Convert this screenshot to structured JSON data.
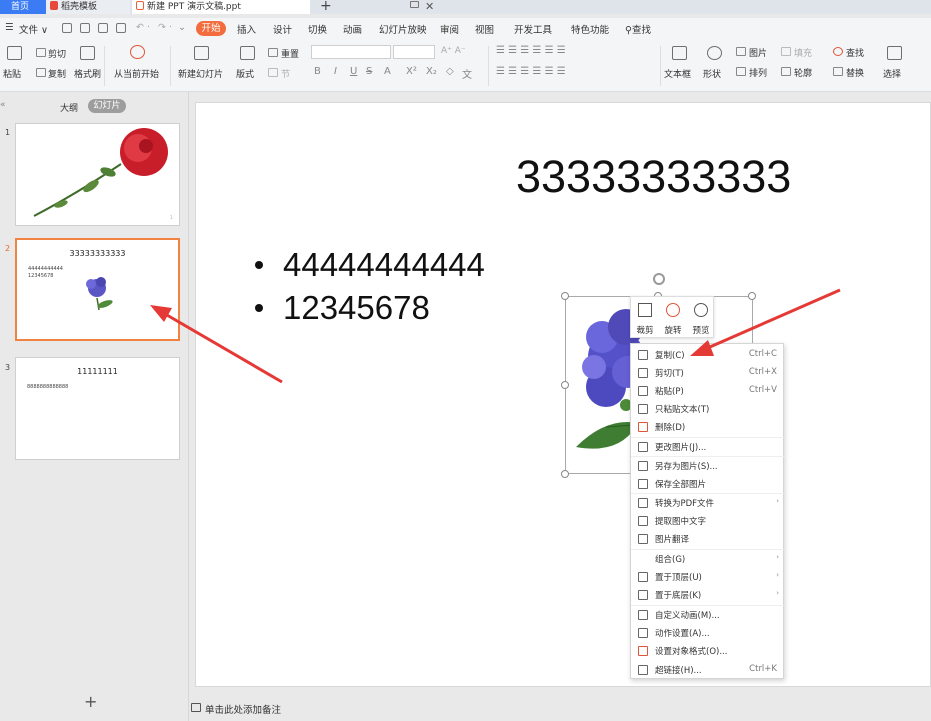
{
  "tabs": {
    "home": "首页",
    "template": "稻壳模板",
    "document": "新建 PPT 演示文稿.ppt",
    "close": "✕",
    "add": "+"
  },
  "menu": {
    "file": "文件",
    "items": [
      "开始",
      "插入",
      "设计",
      "切换",
      "动画",
      "幻灯片放映",
      "审阅",
      "视图",
      "开发工具",
      "特色功能"
    ],
    "search": "查找"
  },
  "ribbon": {
    "paste": "粘贴",
    "cut": "剪切",
    "copy": "复制",
    "format_painter": "格式刷",
    "from_current": "从当前开始",
    "new_slide": "新建幻灯片",
    "layout": "版式",
    "reset": "重置",
    "section": "节",
    "textbox": "文本框",
    "shape": "形状",
    "picture": "图片",
    "fill": "填充",
    "arrange": "排列",
    "outline": "轮廓",
    "find": "查找",
    "replace": "替换",
    "select": "选择"
  },
  "sidebar": {
    "outline_tab": "大纲",
    "slides_tab": "幻灯片",
    "thumbs": [
      {
        "num": "1",
        "title": "",
        "bullets": []
      },
      {
        "num": "2",
        "title": "33333333333",
        "bullets": [
          "44444444444",
          "12345678"
        ]
      },
      {
        "num": "3",
        "title": "11111111",
        "bullets": [
          "8888888888888"
        ]
      }
    ]
  },
  "slide": {
    "title": "33333333333",
    "bullets": [
      "44444444444",
      "12345678"
    ]
  },
  "float_toolbar": {
    "crop": "裁剪",
    "rotate": "旋转",
    "preview": "预览"
  },
  "context_menu": [
    {
      "label": "复制(C)",
      "shortcut": "Ctrl+C",
      "icon": "copy-icon"
    },
    {
      "label": "剪切(T)",
      "shortcut": "Ctrl+X",
      "icon": "scissors-icon"
    },
    {
      "label": "粘贴(P)",
      "shortcut": "Ctrl+V",
      "icon": "paste-icon"
    },
    {
      "label": "只粘贴文本(T)",
      "shortcut": "",
      "icon": "paste-text-icon"
    },
    {
      "label": "删除(D)",
      "shortcut": "",
      "icon": "delete-icon"
    },
    {
      "label": "更改图片(J)...",
      "shortcut": "",
      "icon": "change-picture-icon"
    },
    {
      "label": "另存为图片(S)...",
      "shortcut": "",
      "icon": "save-as-picture-icon"
    },
    {
      "label": "保存全部图片",
      "shortcut": "",
      "icon": "save-all-pictures-icon"
    },
    {
      "label": "转换为PDF文件",
      "shortcut": "",
      "icon": "pdf-icon",
      "submenu": true
    },
    {
      "label": "提取图中文字",
      "shortcut": "",
      "icon": "extract-text-icon"
    },
    {
      "label": "图片翻译",
      "shortcut": "",
      "icon": "translate-icon"
    },
    {
      "label": "组合(G)",
      "shortcut": "",
      "icon": "",
      "submenu": true
    },
    {
      "label": "置于顶层(U)",
      "shortcut": "",
      "icon": "bring-to-front-icon",
      "submenu": true
    },
    {
      "label": "置于底层(K)",
      "shortcut": "",
      "icon": "send-to-back-icon",
      "submenu": true
    },
    {
      "label": "自定义动画(M)...",
      "shortcut": "",
      "icon": "custom-animation-icon"
    },
    {
      "label": "动作设置(A)...",
      "shortcut": "",
      "icon": "action-settings-icon"
    },
    {
      "label": "设置对象格式(O)...",
      "shortcut": "",
      "icon": "format-object-icon"
    },
    {
      "label": "超链接(H)...",
      "shortcut": "Ctrl+K",
      "icon": "hyperlink-icon"
    }
  ],
  "notes": {
    "placeholder": "单击此处添加备注"
  },
  "colors": {
    "accent": "#f36c3d",
    "home_tab": "#3b7cf4",
    "arrow": "#e53935",
    "selected_thumb": "#f2823f"
  }
}
